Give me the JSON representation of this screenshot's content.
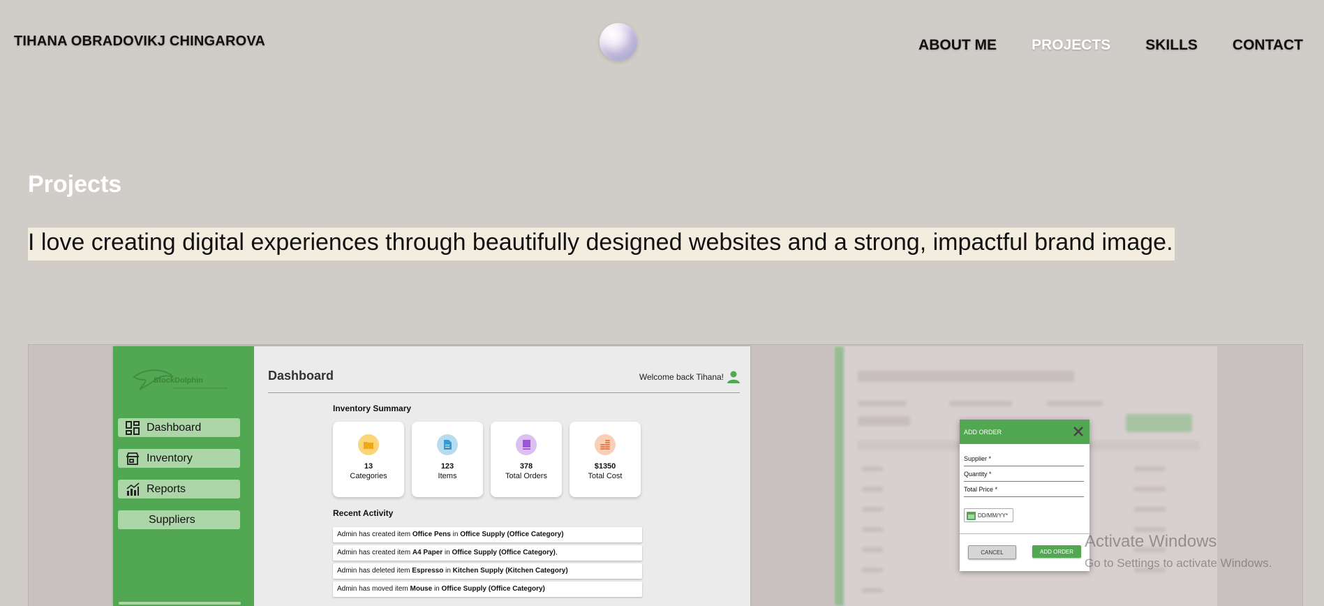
{
  "header": {
    "brand": "TIHANA OBRADOVIKJ CHINGAROVA",
    "nav": [
      {
        "label": "ABOUT ME",
        "active": false
      },
      {
        "label": "PROJECTS",
        "active": true
      },
      {
        "label": "SKILLS",
        "active": false
      },
      {
        "label": "CONTACT",
        "active": false
      }
    ]
  },
  "section": {
    "title": "Projects",
    "tagline": "I love creating digital experiences through beautifully designed websites and a strong, impactful brand image."
  },
  "project1": {
    "logo_text": "StockDolphin",
    "sidebar": [
      "Dashboard",
      "Inventory",
      "Reports",
      "Suppliers"
    ],
    "dashboard_title": "Dashboard",
    "welcome": "Welcome back Tihana!",
    "inventory_title": "Inventory Summary",
    "cards": [
      {
        "value": "13",
        "label": "Categories",
        "color": "#fbd57a",
        "icon_color": "#f0a818"
      },
      {
        "value": "123",
        "label": "Items",
        "color": "#b8dcef",
        "icon_color": "#3a98d0"
      },
      {
        "value": "378",
        "label": "Total Orders",
        "color": "#dcc0f1",
        "icon_color": "#9b55d6"
      },
      {
        "value": "$1350",
        "label": "Total Cost",
        "color": "#f8cfb9",
        "icon_color": "#ee7a45"
      }
    ],
    "recent_title": "Recent Activity",
    "activity": [
      {
        "pre": "Admin has created item ",
        "item": "Office Pens",
        "mid": " in ",
        "cat": "Office Supply (Office Category)",
        "post": ""
      },
      {
        "pre": "Admin has created item ",
        "item": "A4 Paper",
        "mid": " in ",
        "cat": "Office Supply (Office Category)",
        "post": ","
      },
      {
        "pre": "Admin has deleted item ",
        "item": "Espresso",
        "mid": " in ",
        "cat": "Kitchen Supply (Kitchen Category)",
        "post": ""
      },
      {
        "pre": "Admin has moved item ",
        "item": "Mouse",
        "mid": " in ",
        "cat": "Office Supply (Office Category)",
        "post": ""
      }
    ]
  },
  "project2": {
    "modal_title": "ADD ORDER",
    "fields": [
      "Supplier *",
      "Quantity *",
      "Total Price *"
    ],
    "date_placeholder": "DD/MM/YY*",
    "cancel": "CANCEL",
    "add": "ADD ORDER"
  },
  "os_watermark": {
    "line1": "Activate Windows",
    "line2": "Go to Settings to activate Windows."
  },
  "colors": {
    "page_bg": "#d0cdc8",
    "accent_green": "#52a852",
    "highlight": "#f3ede0"
  }
}
